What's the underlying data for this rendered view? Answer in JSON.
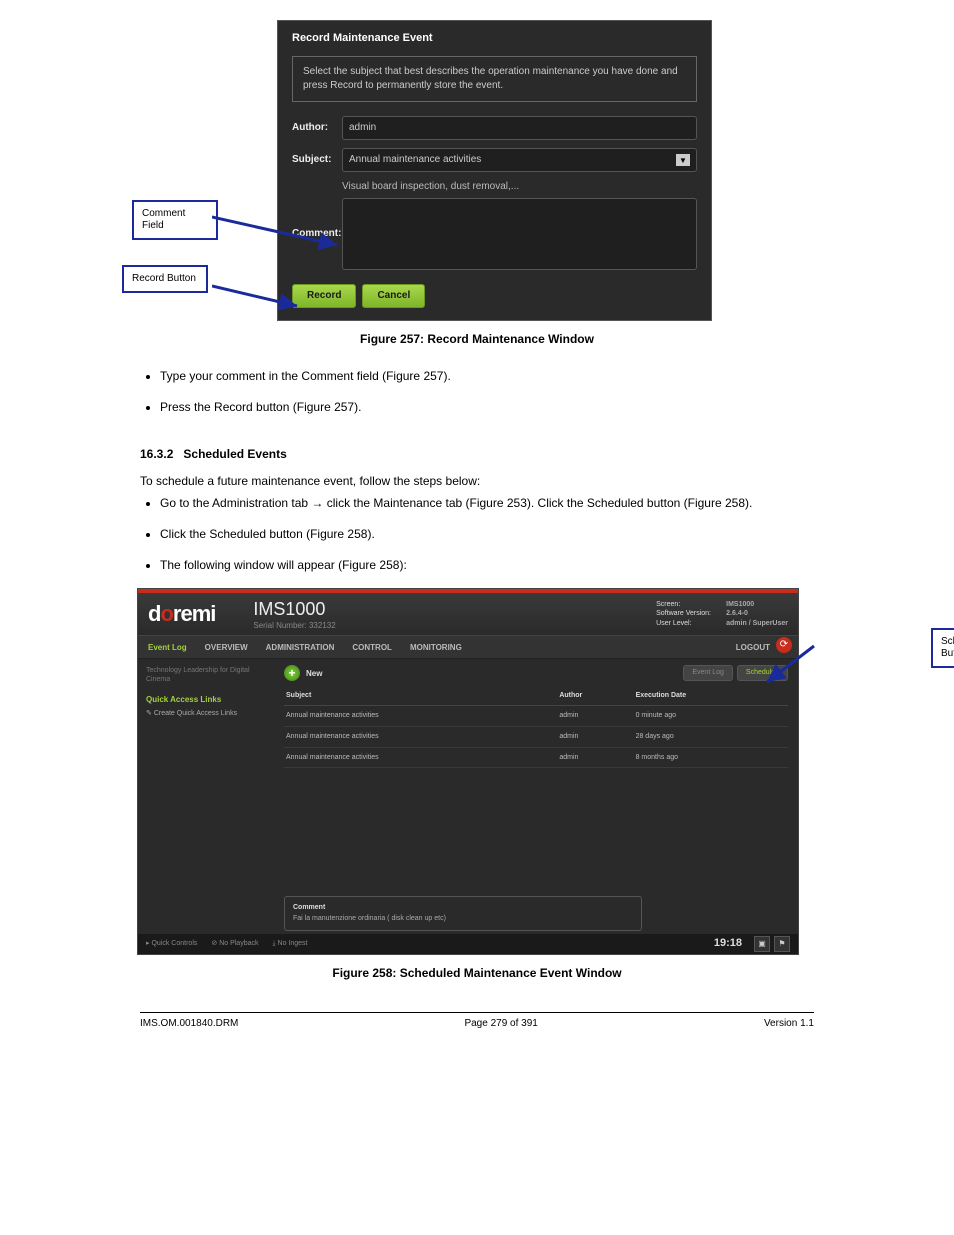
{
  "section1": {
    "dialog_title": "Record Maintenance Event",
    "instruction": "Select the subject that best describes the operation maintenance you have done and press Record to permanently store the event.",
    "author_label": "Author:",
    "author_value": "admin",
    "subject_label": "Subject:",
    "subject_value": "Annual maintenance activities",
    "hint": "Visual board inspection, dust removal,...",
    "comment_label": "Comment:",
    "record_btn": "Record",
    "cancel_btn": "Cancel",
    "callout_comment": "Comment Field",
    "callout_record": "Record Button",
    "caption": "Figure 257: Record Maintenance Window",
    "bullet1": "Type your comment in the Comment field (Figure 257).",
    "bullet2": "Press the Record button (Figure 257)."
  },
  "section2": {
    "heading_num": "16.3.2",
    "heading_txt": "Scheduled Events",
    "intro": "To schedule a future maintenance event, follow the steps below:",
    "b1_a": "Go to the Administration tab → click the Maintenance tab (Figure 253).",
    "b1_b": " Click the Scheduled button (Figure 258).",
    "b2": "Click the Scheduled button (Figure 258).",
    "b3": "The following window will appear (Figure 258):"
  },
  "app": {
    "logo_pre": "d",
    "logo_o": "o",
    "logo_post": "remi",
    "product": "IMS1000",
    "serial": "Serial Number: 332132",
    "meta": {
      "screen_l": "Screen:",
      "screen_v": "IMS1000",
      "ver_l": "Software Version:",
      "ver_v": "2.6.4-0",
      "user_l": "User Level:",
      "user_v": "admin / SuperUser"
    },
    "tabs": {
      "active": "Event Log",
      "t1": "OVERVIEW",
      "t2": "ADMINISTRATION",
      "t3": "CONTROL",
      "t4": "MONITORING",
      "logout": "LOGOUT"
    },
    "side": {
      "tl": "Technology Leadership for Digital Cinema",
      "qal": "Quick Access Links",
      "cql": "Create Quick Access Links"
    },
    "new_lbl": "New",
    "toggle": {
      "a": "Event Log",
      "b": "Scheduled"
    },
    "cols": {
      "c1": "Subject",
      "c2": "Author",
      "c3": "Execution Date"
    },
    "rows": [
      {
        "s": "Annual maintenance activities",
        "a": "admin",
        "d": "0 minute ago"
      },
      {
        "s": "Annual maintenance activities",
        "a": "admin",
        "d": "28 days ago"
      },
      {
        "s": "Annual maintenance activities",
        "a": "admin",
        "d": "8 months ago"
      }
    ],
    "comment_t": "Comment",
    "comment_b": "Fai la manutenzione ordinaria ( disk clean up etc)",
    "status": {
      "s1": "Quick Controls",
      "s2": "No Playback",
      "s3": "No Ingest",
      "time": "19:18"
    },
    "callout_sched": "Scheduled Button",
    "caption": "Figure 258: Scheduled Maintenance Event Window"
  },
  "footer": {
    "l": "IMS.OM.001840.DRM",
    "c": "Page 279 of 391",
    "r": "Version 1.1"
  }
}
